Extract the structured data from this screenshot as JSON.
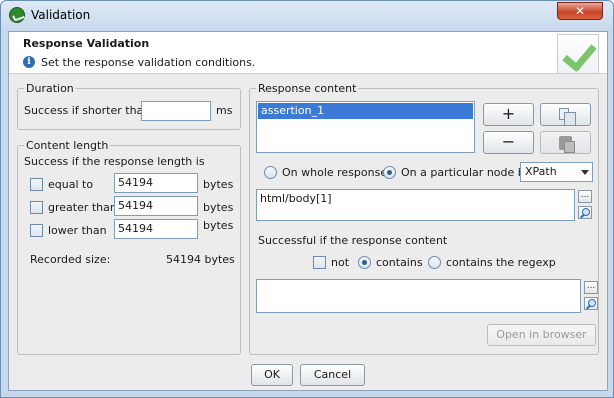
{
  "window": {
    "title": "Validation",
    "close_label": "✕"
  },
  "header": {
    "title": "Response Validation",
    "subtitle": "Set the response validation conditions."
  },
  "duration": {
    "group_title": "Duration",
    "success_label": "Success if shorter than",
    "value": "",
    "unit": "ms"
  },
  "content_length": {
    "group_title": "Content length",
    "intro": "Success if the response length is",
    "rows": [
      {
        "label": "equal to",
        "value": "54194",
        "unit": "bytes",
        "checked": false
      },
      {
        "label": "greater than",
        "value": "54194",
        "unit": "bytes",
        "checked": false
      },
      {
        "label": "lower than",
        "value": "54194",
        "unit": "bytes",
        "checked": false
      }
    ],
    "recorded_label": "Recorded size:",
    "recorded_value": "54194 bytes"
  },
  "response_content": {
    "group_title": "Response content",
    "assertions": [
      "assertion_1"
    ],
    "add_label": "+",
    "remove_label": "−",
    "scope_whole": "On whole response",
    "scope_node": "On a particular node by",
    "node_type": "XPath",
    "node_path": "html/body[1]",
    "browse_label": "...",
    "success_label": "Successful if the response content",
    "not_label": "not",
    "contains_label": "contains",
    "regexp_label": "contains the regexp",
    "content_value": "",
    "open_browser_label": "Open in browser"
  },
  "footer": {
    "ok_label": "OK",
    "cancel_label": "Cancel"
  }
}
